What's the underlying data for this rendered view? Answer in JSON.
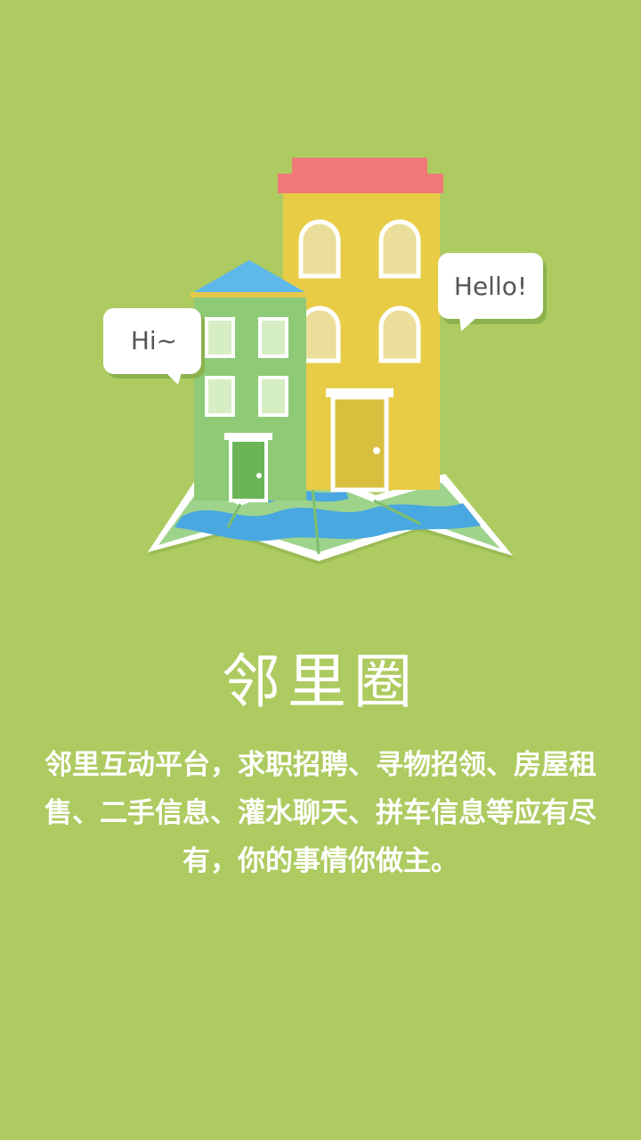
{
  "illustration": {
    "bubble_left": "Hi~",
    "bubble_right": "Hello!",
    "colors": {
      "background": "#adcb60",
      "yellow_building": "#e8cc46",
      "roof": "#f07878",
      "green_building": "#8fca77",
      "blue_roof": "#5eb8ea",
      "map_land": "#9ed38c",
      "map_water": "#4aa8e0"
    }
  },
  "app": {
    "title": "邻里圈",
    "description": "邻里互动平台，求职招聘、寻物招领、房屋租售、二手信息、灌水聊天、拼车信息等应有尽有，你的事情你做主。"
  }
}
